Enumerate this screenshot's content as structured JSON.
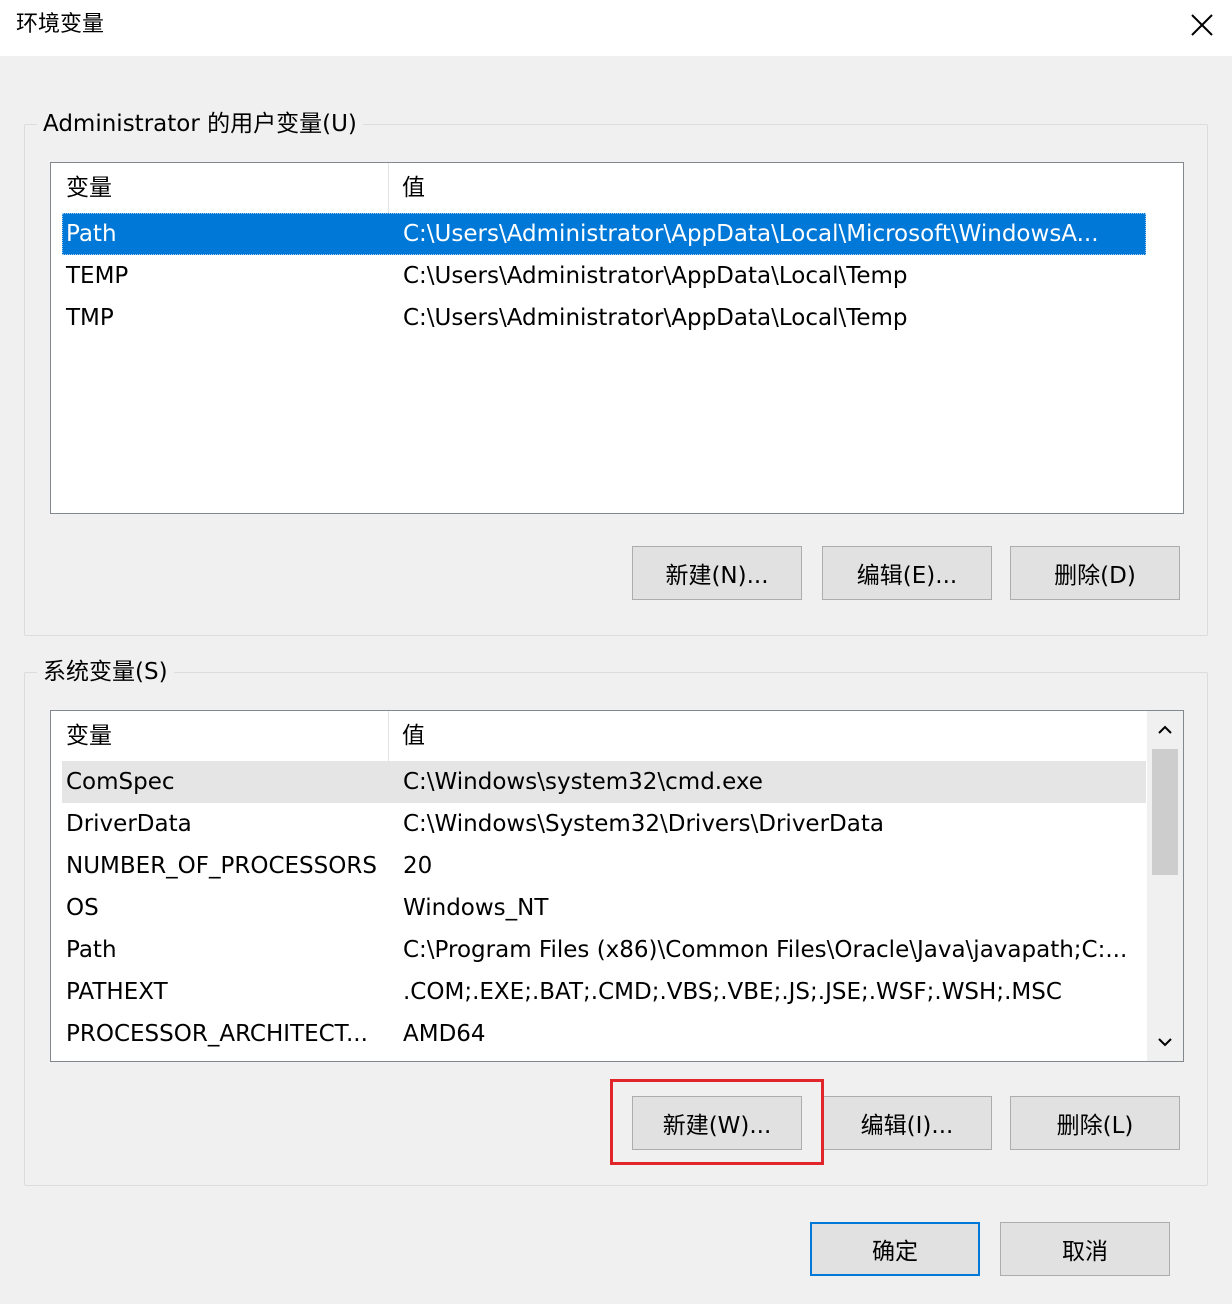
{
  "window": {
    "title": "环境变量",
    "close_icon": "close-icon"
  },
  "user_vars": {
    "group_title": "Administrator 的用户变量(U)",
    "columns": [
      "变量",
      "值"
    ],
    "rows": [
      {
        "name": "Path",
        "value": "C:\\Users\\Administrator\\AppData\\Local\\Microsoft\\WindowsA...",
        "selected": true
      },
      {
        "name": "TEMP",
        "value": "C:\\Users\\Administrator\\AppData\\Local\\Temp"
      },
      {
        "name": "TMP",
        "value": "C:\\Users\\Administrator\\AppData\\Local\\Temp"
      }
    ],
    "buttons": {
      "new": "新建(N)...",
      "edit": "编辑(E)...",
      "delete": "删除(D)"
    }
  },
  "system_vars": {
    "group_title": "系统变量(S)",
    "columns": [
      "变量",
      "值"
    ],
    "rows": [
      {
        "name": "ComSpec",
        "value": "C:\\Windows\\system32\\cmd.exe",
        "hover": true
      },
      {
        "name": "DriverData",
        "value": "C:\\Windows\\System32\\Drivers\\DriverData"
      },
      {
        "name": "NUMBER_OF_PROCESSORS",
        "value": "20"
      },
      {
        "name": "OS",
        "value": "Windows_NT"
      },
      {
        "name": "Path",
        "value": "C:\\Program Files (x86)\\Common Files\\Oracle\\Java\\javapath;C:..."
      },
      {
        "name": "PATHEXT",
        "value": ".COM;.EXE;.BAT;.CMD;.VBS;.VBE;.JS;.JSE;.WSF;.WSH;.MSC"
      },
      {
        "name": "PROCESSOR_ARCHITECT...",
        "value": "AMD64"
      }
    ],
    "buttons": {
      "new": "新建(W)...",
      "edit": "编辑(I)...",
      "delete": "删除(L)"
    }
  },
  "footer": {
    "ok": "确定",
    "cancel": "取消"
  },
  "colors": {
    "selection": "#0078d7",
    "highlight_box": "#e0262b"
  }
}
